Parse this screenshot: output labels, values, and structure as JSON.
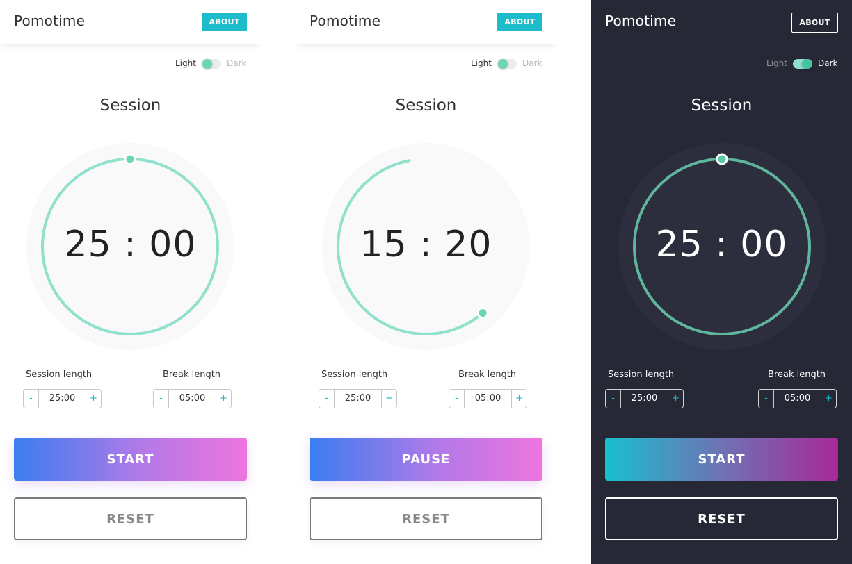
{
  "app": {
    "title": "Pomotime",
    "about_label": "ABOUT",
    "theme_light_label": "Light",
    "theme_dark_label": "Dark",
    "session_label": "Session",
    "session_length_label": "Session length",
    "break_length_label": "Break length",
    "reset_label": "RESET"
  },
  "colors": {
    "accent_teal": "#1dbcca",
    "ring_green": "#8fe0cc",
    "ring_green_dark": "#5fb69c",
    "dark_bg": "#262836"
  },
  "icons": {
    "decrement": "minus-icon",
    "increment": "plus-icon"
  },
  "panels": [
    {
      "theme": "light",
      "time_display": "25 : 00",
      "session_length": "25:00",
      "break_length": "05:00",
      "primary_label": "START",
      "minus_glyph": "-",
      "plus_glyph": "+",
      "progress_remaining": 1.0
    },
    {
      "theme": "light",
      "time_display": "15 : 20",
      "session_length": "25:00",
      "break_length": "05:00",
      "primary_label": "PAUSE",
      "minus_glyph": "-",
      "plus_glyph": "+",
      "progress_remaining": 0.613
    },
    {
      "theme": "dark",
      "time_display": "25 : 00",
      "session_length": "25:00",
      "break_length": "05:00",
      "primary_label": "START",
      "minus_glyph": "-",
      "plus_glyph": "+",
      "progress_remaining": 1.0
    }
  ]
}
